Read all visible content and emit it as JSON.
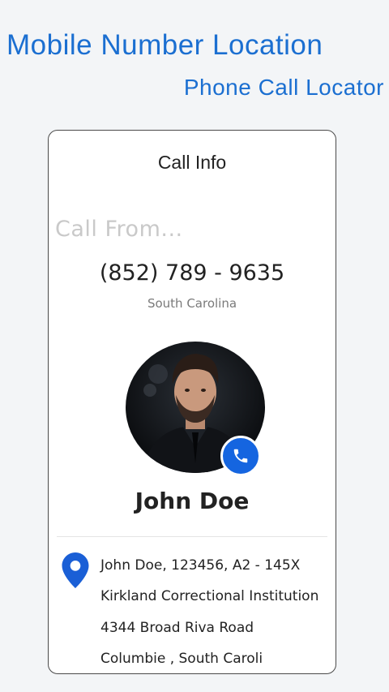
{
  "header": {
    "title": "Mobile Number Location",
    "subtitle": "Phone Call Locator"
  },
  "card": {
    "heading": "Call Info",
    "call_from": "Call From...",
    "phone_number": "(852) 789 - 9635",
    "region": "South Carolina",
    "caller_name": "John Doe",
    "address_lines": [
      "John Doe, 123456, A2 - 145X",
      "Kirkland Correctional Institution",
      "4344 Broad Riva Road",
      "Columbie , South Caroli"
    ]
  },
  "icons": {
    "call_badge": "phone-icon",
    "location": "location-pin-icon"
  },
  "colors": {
    "accent": "#1b6fd1",
    "badge": "#1565e0",
    "pin": "#1a5fd6",
    "background": "#f3f5f7"
  }
}
